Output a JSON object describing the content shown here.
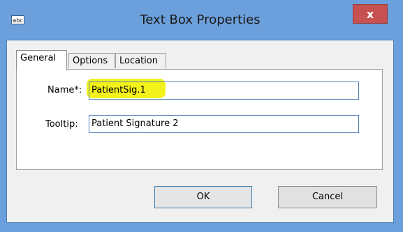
{
  "window": {
    "title": "Text Box Properties",
    "icon_text": "abc",
    "close_label": "x"
  },
  "tabs": [
    {
      "label": "General",
      "active": true
    },
    {
      "label": "Options",
      "active": false
    },
    {
      "label": "Location",
      "active": false
    }
  ],
  "fields": {
    "name": {
      "label": "Name*:",
      "value": "PatientSig.1"
    },
    "tooltip": {
      "label": "Tooltip:",
      "value": "Patient Signature 2"
    }
  },
  "buttons": {
    "ok": "OK",
    "cancel": "Cancel"
  },
  "colors": {
    "titlebar": "#6ca0dc",
    "close": "#c75050",
    "highlight": "#f3f21a"
  }
}
